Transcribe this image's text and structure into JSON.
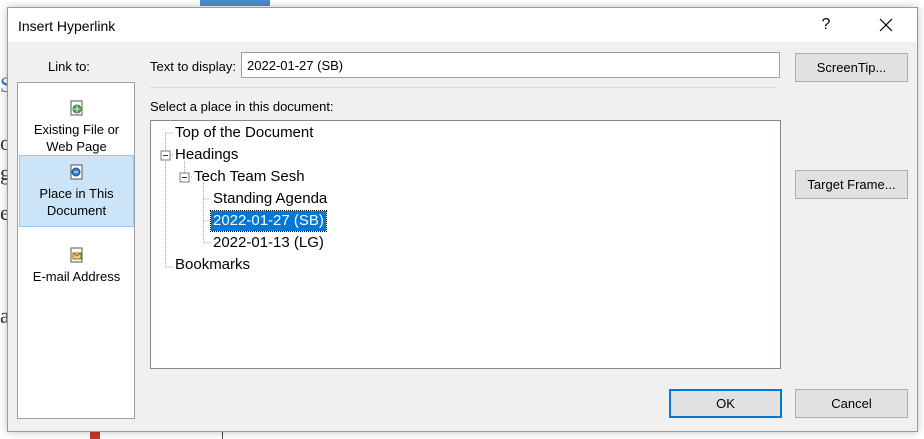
{
  "dialog": {
    "title": "Insert Hyperlink",
    "help": "?",
    "link_to_label": "Link to:",
    "link_to_items": [
      {
        "line1": "Existing File or",
        "line2": "Web Page",
        "icon": "globe-file-icon",
        "selected": false
      },
      {
        "line1": "Place in This",
        "line2": "Document",
        "icon": "document-place-icon",
        "selected": true
      },
      {
        "line1": "E-mail Address",
        "line2": "",
        "icon": "email-icon",
        "selected": false
      }
    ],
    "text_to_display_label": "Text to display:",
    "text_to_display_value": "2022-01-27 (SB)",
    "screentip_button": "ScreenTip...",
    "select_place_label": "Select a place in this document:",
    "tree": {
      "top": "Top of the Document",
      "headings": "Headings",
      "tech_team": "Tech Team Sesh",
      "standing": "Standing Agenda",
      "item_selected": "2022-01-27 (SB)",
      "item_other": "2022-01-13 (LG)",
      "bookmarks": "Bookmarks"
    },
    "target_frame_button": "Target Frame...",
    "ok_button": "OK",
    "cancel_button": "Cancel"
  }
}
